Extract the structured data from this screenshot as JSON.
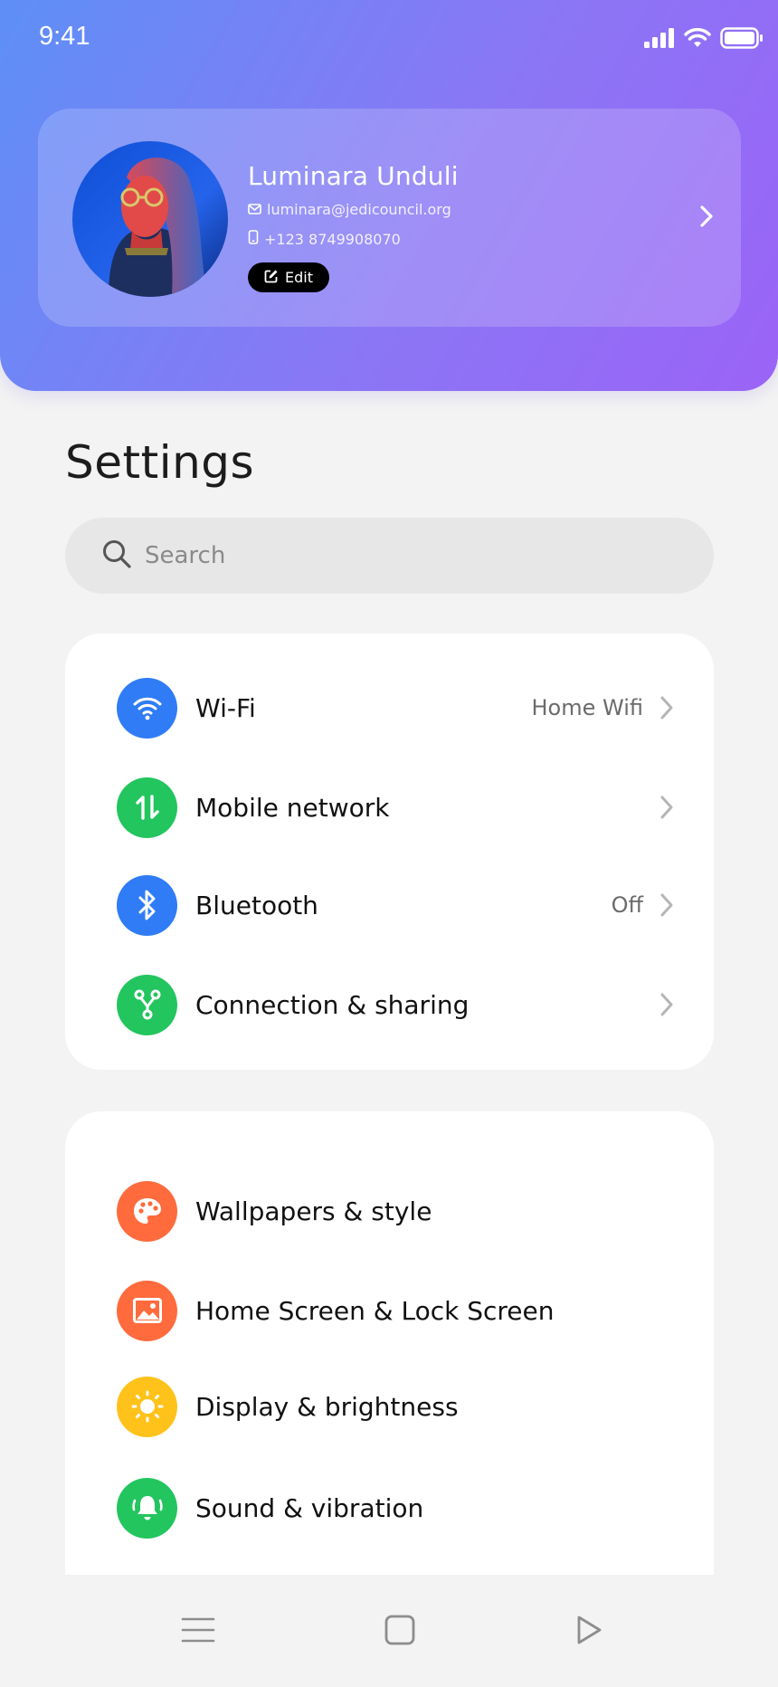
{
  "status_bar": {
    "time": "9:41"
  },
  "profile": {
    "name": "Luminara Unduli",
    "email": "luminara@jedicouncil.org",
    "phone": "+123 8749908070",
    "edit_label": "Edit"
  },
  "page_title": "Settings",
  "search": {
    "placeholder": "Search",
    "value": ""
  },
  "groups": [
    {
      "items": [
        {
          "label": "Wi-Fi",
          "value": "Home Wifi",
          "icon": "wifi-icon",
          "color": "#2f7cf6"
        },
        {
          "label": "Mobile network",
          "value": "",
          "icon": "mobile-data-icon",
          "color": "#22c55e"
        },
        {
          "label": "Bluetooth",
          "value": "Off",
          "icon": "bluetooth-icon",
          "color": "#2f7cf6"
        },
        {
          "label": "Connection & sharing",
          "value": "",
          "icon": "share-fork-icon",
          "color": "#22c55e"
        }
      ]
    },
    {
      "items": [
        {
          "label": "Wallpapers & style",
          "icon": "palette-icon",
          "color": "#ff6b3d"
        },
        {
          "label": "Home Screen & Lock Screen",
          "icon": "image-icon",
          "color": "#ff6b3d"
        },
        {
          "label": "Display & brightness",
          "icon": "sun-icon",
          "color": "#ffc21a"
        },
        {
          "label": "Sound & vibration",
          "icon": "bell-ringing-icon",
          "color": "#22c55e"
        }
      ]
    }
  ],
  "colors": {
    "header_gradient_start": "#5e8ff7",
    "header_gradient_end": "#9b63f7",
    "background": "#f3f3f3"
  }
}
